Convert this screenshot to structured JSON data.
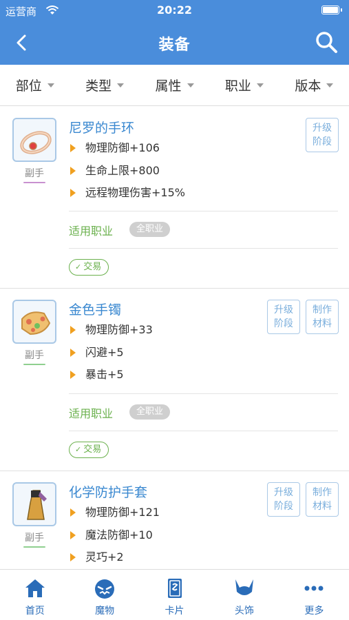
{
  "status_bar": {
    "carrier": "运营商",
    "time": "20:22"
  },
  "nav": {
    "title": "装备"
  },
  "filters": [
    {
      "label": "部位"
    },
    {
      "label": "类型"
    },
    {
      "label": "属性"
    },
    {
      "label": "职业"
    },
    {
      "label": "版本"
    }
  ],
  "items": [
    {
      "name": "尼罗的手环",
      "slot": "副手",
      "stats": [
        "物理防御+106",
        "生命上限+800",
        "远程物理伤害+15%"
      ],
      "buttons": [
        "升级\n阶段"
      ],
      "job_label": "适用职业",
      "job_value": "全职业",
      "trade": "交易",
      "accent": "#c890d0"
    },
    {
      "name": "金色手镯",
      "slot": "副手",
      "stats": [
        "物理防御+33",
        "闪避+5",
        "暴击+5"
      ],
      "buttons": [
        "升级\n阶段",
        "制作\n材料"
      ],
      "job_label": "适用职业",
      "job_value": "全职业",
      "trade": "交易",
      "accent": "#8fcf8f"
    },
    {
      "name": "化学防护手套",
      "slot": "副手",
      "stats": [
        "物理防御+121",
        "魔法防御+10",
        "灵巧+2"
      ],
      "buttons": [
        "升级\n阶段",
        "制作\n材料"
      ],
      "accent": "#8fcf8f"
    }
  ],
  "tabs": [
    {
      "label": "首页",
      "icon": "home-icon"
    },
    {
      "label": "魔物",
      "icon": "monster-icon"
    },
    {
      "label": "卡片",
      "icon": "card-icon"
    },
    {
      "label": "头饰",
      "icon": "headwear-icon"
    },
    {
      "label": "更多",
      "icon": "more-icon"
    }
  ],
  "colors": {
    "primary": "#4a8ddb",
    "link": "#3a88d0",
    "green": "#6ab04c",
    "bullet": "#f0a020"
  }
}
